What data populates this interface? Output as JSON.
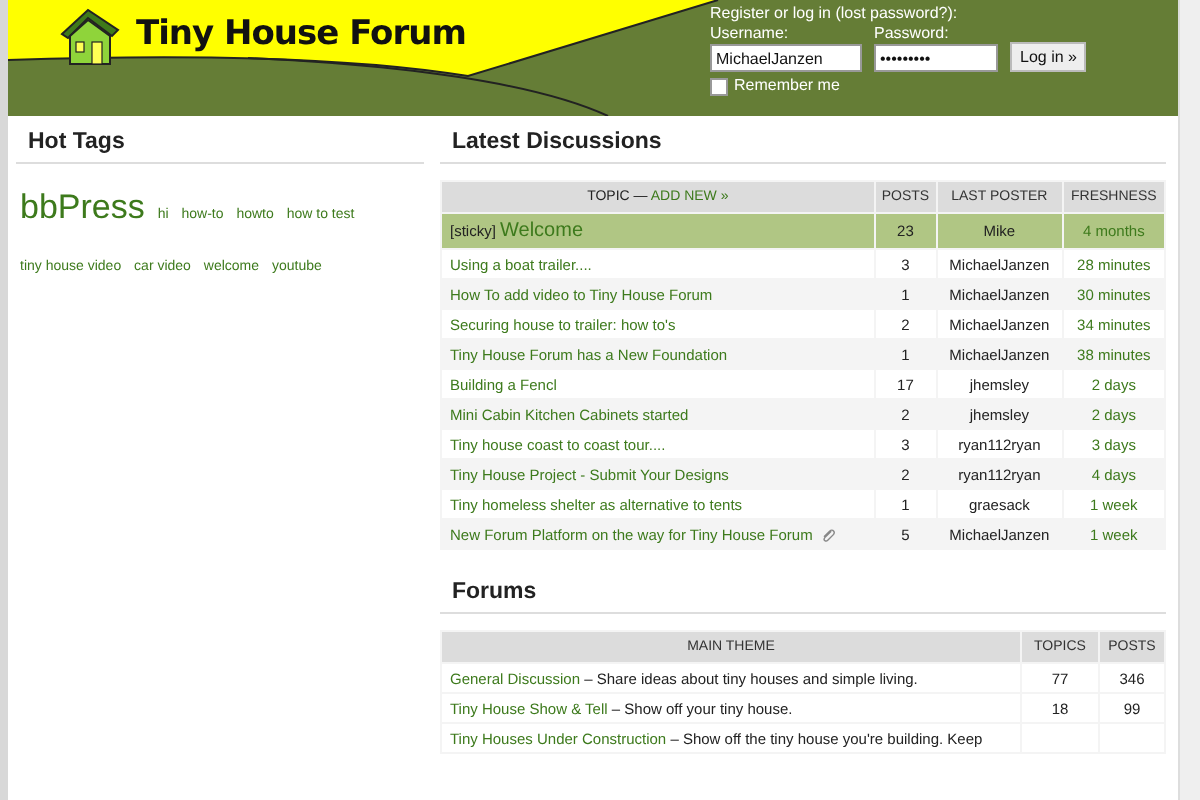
{
  "header": {
    "logo_text": "Tiny House Forum",
    "login": {
      "prompt": "Register or log in (lost password?):",
      "username_label": "Username:",
      "username": "MichaelJanzen",
      "password_label": "Password:",
      "password": "•••••••••",
      "remember_label": "Remember me",
      "remember_checked": false,
      "button": "Log in »"
    }
  },
  "hot_tags": {
    "title": "Hot Tags",
    "tags": [
      {
        "label": "bbPress",
        "popular": true
      },
      {
        "label": "hi",
        "popular": false
      },
      {
        "label": "how-to",
        "popular": false
      },
      {
        "label": "howto",
        "popular": false
      },
      {
        "label": "how to test",
        "popular": false
      },
      {
        "label": "tiny house video",
        "popular": false
      },
      {
        "label": "car video",
        "popular": false
      },
      {
        "label": "welcome",
        "popular": false
      },
      {
        "label": "youtube",
        "popular": false
      }
    ]
  },
  "latest_discussions": {
    "title": "Latest Discussions",
    "columns": {
      "topic": "TOPIC —",
      "add_new": "ADD NEW »",
      "posts": "POSTS",
      "last_poster": "LAST POSTER",
      "freshness": "FRESHNESS"
    },
    "rows": [
      {
        "title": "Welcome",
        "sticky": true,
        "sticky_label": "[sticky]",
        "posts": "23",
        "poster": "Mike",
        "freshness": "4 months",
        "attachment": false
      },
      {
        "title": "Using a boat trailer....",
        "sticky": false,
        "posts": "3",
        "poster": "MichaelJanzen",
        "freshness": "28 minutes",
        "attachment": false
      },
      {
        "title": "How To add video to Tiny House Forum",
        "sticky": false,
        "posts": "1",
        "poster": "MichaelJanzen",
        "freshness": "30 minutes",
        "attachment": false
      },
      {
        "title": "Securing house to trailer: how to's",
        "sticky": false,
        "posts": "2",
        "poster": "MichaelJanzen",
        "freshness": "34 minutes",
        "attachment": false
      },
      {
        "title": "Tiny House Forum has a New Foundation",
        "sticky": false,
        "posts": "1",
        "poster": "MichaelJanzen",
        "freshness": "38 minutes",
        "attachment": false
      },
      {
        "title": "Building a Fencl",
        "sticky": false,
        "posts": "17",
        "poster": "jhemsley",
        "freshness": "2 days",
        "attachment": false
      },
      {
        "title": "Mini Cabin Kitchen Cabinets started",
        "sticky": false,
        "posts": "2",
        "poster": "jhemsley",
        "freshness": "2 days",
        "attachment": false
      },
      {
        "title": "Tiny house coast to coast tour....",
        "sticky": false,
        "posts": "3",
        "poster": "ryan112ryan",
        "freshness": "3 days",
        "attachment": false
      },
      {
        "title": "Tiny House Project - Submit Your Designs",
        "sticky": false,
        "posts": "2",
        "poster": "ryan112ryan",
        "freshness": "4 days",
        "attachment": false
      },
      {
        "title": "Tiny homeless shelter as alternative to tents",
        "sticky": false,
        "posts": "1",
        "poster": "graesack",
        "freshness": "1 week",
        "attachment": false
      },
      {
        "title": "New Forum Platform on the way for Tiny House Forum",
        "sticky": false,
        "posts": "5",
        "poster": "MichaelJanzen",
        "freshness": "1 week",
        "attachment": true
      }
    ]
  },
  "forums": {
    "title": "Forums",
    "columns": {
      "main_theme": "MAIN THEME",
      "topics": "TOPICS",
      "posts": "POSTS"
    },
    "rows": [
      {
        "name": "General Discussion",
        "description": "– Share ideas about tiny houses and simple living.",
        "topics": "77",
        "posts": "346"
      },
      {
        "name": "Tiny House Show & Tell",
        "description": "– Show off your tiny house.",
        "topics": "18",
        "posts": "99"
      },
      {
        "name": "Tiny Houses Under Construction",
        "description": "– Show off the tiny house you're building. Keep"
      }
    ]
  }
}
